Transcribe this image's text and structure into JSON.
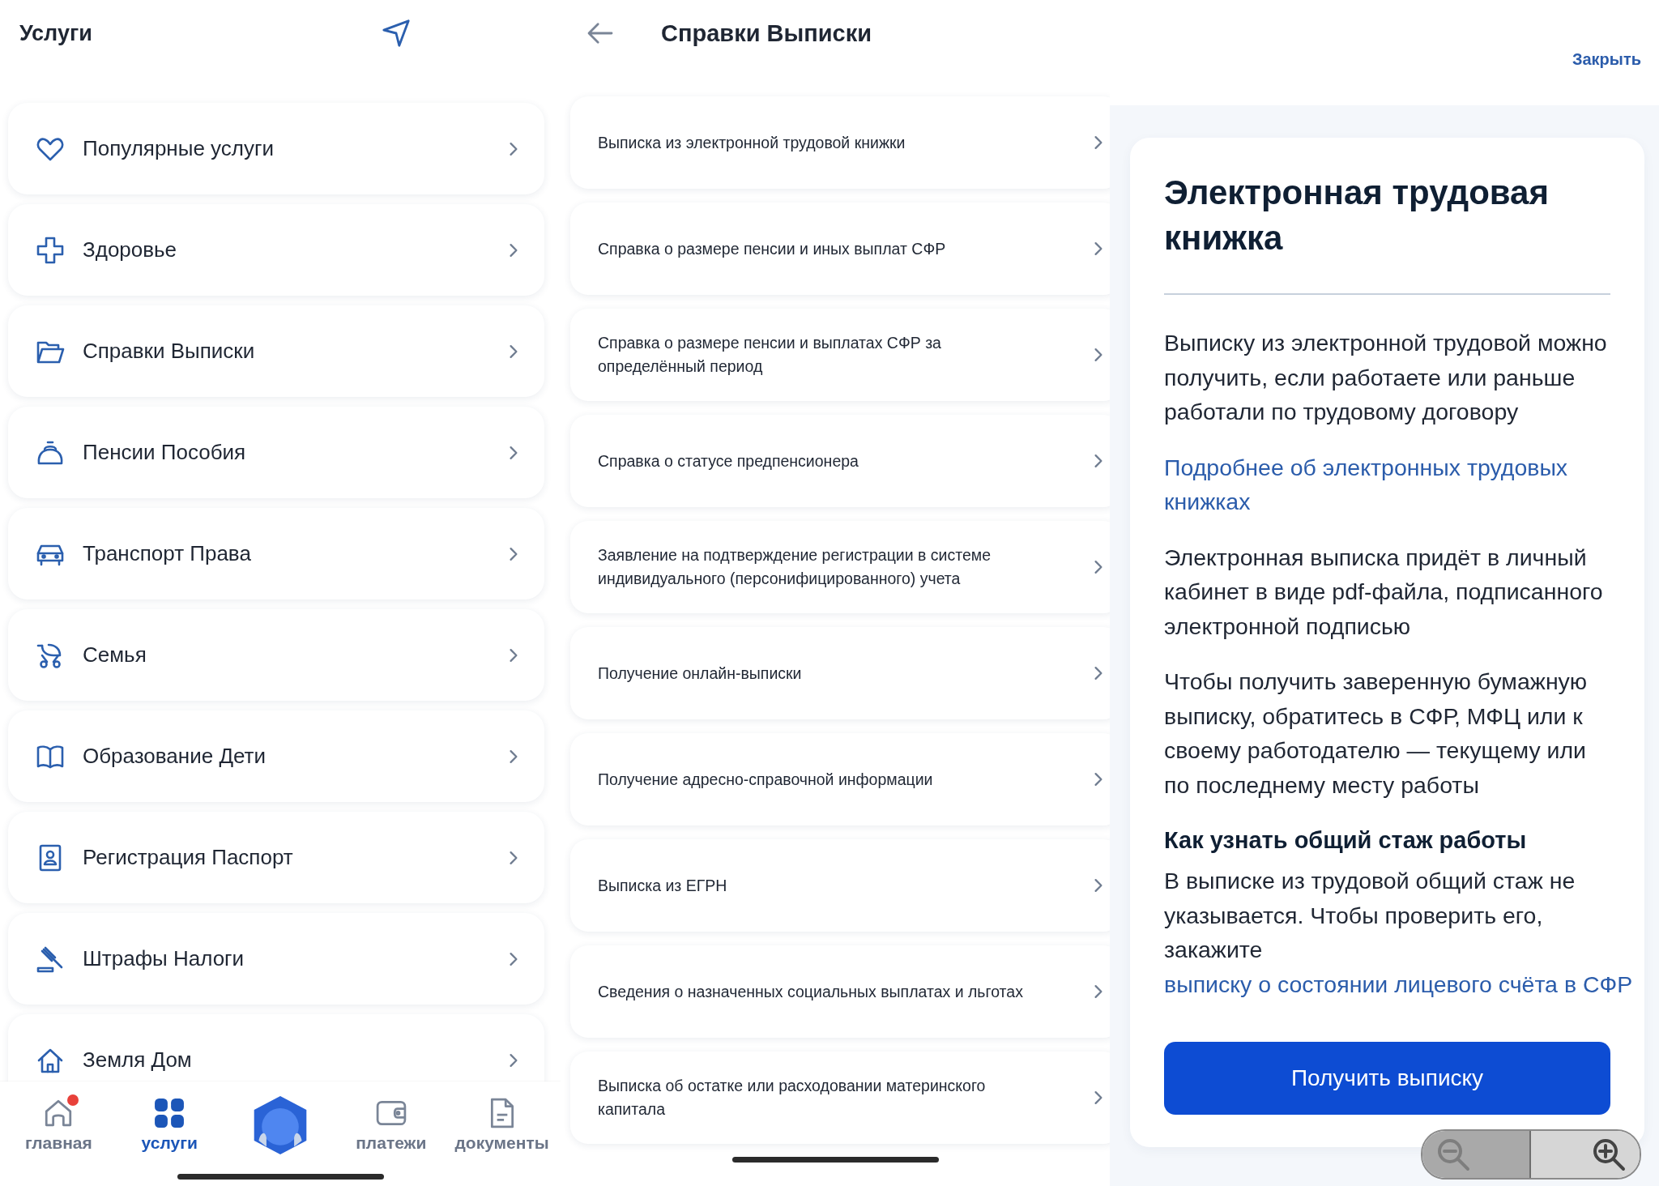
{
  "services": {
    "title": "Услуги",
    "categories": [
      {
        "label": "Популярные услуги"
      },
      {
        "label": "Здоровье"
      },
      {
        "label": "Справки Выписки"
      },
      {
        "label": "Пенсии Пособия"
      },
      {
        "label": "Транспорт Права"
      },
      {
        "label": "Семья"
      },
      {
        "label": "Образование Дети"
      },
      {
        "label": "Регистрация Паспорт"
      },
      {
        "label": "Штрафы Налоги"
      },
      {
        "label": "Земля Дом"
      }
    ]
  },
  "bottom_nav": [
    {
      "kind": "tab",
      "label": "главная",
      "selected": false,
      "notification": true
    },
    {
      "kind": "tab",
      "label": "услуги",
      "selected": true,
      "notification": false
    },
    {
      "kind": "assistant",
      "selected": false
    },
    {
      "kind": "tab",
      "label": "платежи",
      "selected": false,
      "notification": false
    },
    {
      "kind": "tab",
      "label": "документы",
      "selected": false,
      "notification": false
    }
  ],
  "statements": {
    "title": "Справки Выписки",
    "items": [
      {
        "label": "Выписка из электронной трудовой книжки"
      },
      {
        "label": "Справка о размере пенсии и иных выплат СФР"
      },
      {
        "label": "Справка о размере пенсии и выплатах СФР за определённый период"
      },
      {
        "label": "Справка о статусе предпенсионера"
      },
      {
        "label": "Заявление на подтверждение регистрации в системе индивидуального (персонифицированного) учета"
      },
      {
        "label": "Получение онлайн-выписки"
      },
      {
        "label": "Получение адресно-справочной информации"
      },
      {
        "label": "Выписка из ЕГРН"
      },
      {
        "label": "Сведения о назначенных социальных выплатах и льготах"
      },
      {
        "label": "Выписка об остатке или расходовании материнского капитала"
      }
    ]
  },
  "info": {
    "close": "Закрыть",
    "title": "Электронная трудовая книжка",
    "blocks": [
      {
        "kind": "paragraph",
        "text": "Выписку из электронной трудовой можно получить, если работаете или раньше работали по трудовому договору"
      },
      {
        "kind": "link",
        "text": "Подробнее об электронных трудовых книжках"
      },
      {
        "kind": "paragraph",
        "text": "Электронная выписка придёт в личный кабинет в виде pdf-файла, подписанного электронной подписью"
      },
      {
        "kind": "paragraph",
        "text": "Чтобы получить заверенную бумажную выписку, обратитесь в СФР, МФЦ или к своему работодателю — текущему или по последнему месту работы"
      },
      {
        "kind": "heading",
        "text": "Как узнать общий стаж работы"
      },
      {
        "kind": "paragraph",
        "text": "В выписке из трудовой общий стаж не указывается. Чтобы проверить его, закажите",
        "link": "выписку о состоянии лицевого счёта в СФР"
      }
    ],
    "button": "Получить выписку"
  }
}
